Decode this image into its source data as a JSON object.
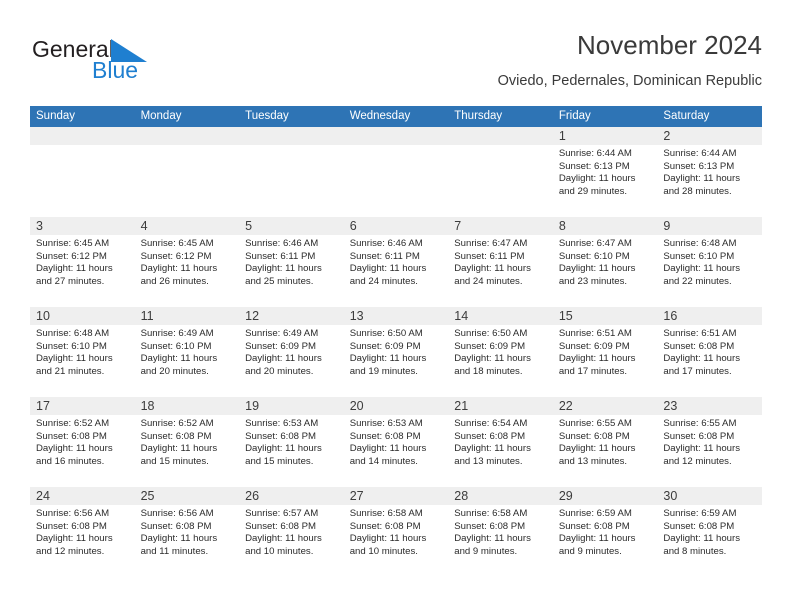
{
  "brand": {
    "name_part1": "General",
    "name_part2": "Blue",
    "accent_color": "#1f7fd0",
    "flag_icon": "blue-flag-triangle-icon"
  },
  "header": {
    "title": "November 2024",
    "subtitle": "Oviedo, Pedernales, Dominican Republic"
  },
  "calendar": {
    "header_bg": "#2e74b5",
    "daynum_bg": "#efefef",
    "weekday_headers": [
      "Sunday",
      "Monday",
      "Tuesday",
      "Wednesday",
      "Thursday",
      "Friday",
      "Saturday"
    ],
    "weeks": [
      [
        {
          "day": "",
          "details": ""
        },
        {
          "day": "",
          "details": ""
        },
        {
          "day": "",
          "details": ""
        },
        {
          "day": "",
          "details": ""
        },
        {
          "day": "",
          "details": ""
        },
        {
          "day": "1",
          "details": "Sunrise: 6:44 AM\nSunset: 6:13 PM\nDaylight: 11 hours\nand 29 minutes."
        },
        {
          "day": "2",
          "details": "Sunrise: 6:44 AM\nSunset: 6:13 PM\nDaylight: 11 hours\nand 28 minutes."
        }
      ],
      [
        {
          "day": "3",
          "details": "Sunrise: 6:45 AM\nSunset: 6:12 PM\nDaylight: 11 hours\nand 27 minutes."
        },
        {
          "day": "4",
          "details": "Sunrise: 6:45 AM\nSunset: 6:12 PM\nDaylight: 11 hours\nand 26 minutes."
        },
        {
          "day": "5",
          "details": "Sunrise: 6:46 AM\nSunset: 6:11 PM\nDaylight: 11 hours\nand 25 minutes."
        },
        {
          "day": "6",
          "details": "Sunrise: 6:46 AM\nSunset: 6:11 PM\nDaylight: 11 hours\nand 24 minutes."
        },
        {
          "day": "7",
          "details": "Sunrise: 6:47 AM\nSunset: 6:11 PM\nDaylight: 11 hours\nand 24 minutes."
        },
        {
          "day": "8",
          "details": "Sunrise: 6:47 AM\nSunset: 6:10 PM\nDaylight: 11 hours\nand 23 minutes."
        },
        {
          "day": "9",
          "details": "Sunrise: 6:48 AM\nSunset: 6:10 PM\nDaylight: 11 hours\nand 22 minutes."
        }
      ],
      [
        {
          "day": "10",
          "details": "Sunrise: 6:48 AM\nSunset: 6:10 PM\nDaylight: 11 hours\nand 21 minutes."
        },
        {
          "day": "11",
          "details": "Sunrise: 6:49 AM\nSunset: 6:10 PM\nDaylight: 11 hours\nand 20 minutes."
        },
        {
          "day": "12",
          "details": "Sunrise: 6:49 AM\nSunset: 6:09 PM\nDaylight: 11 hours\nand 20 minutes."
        },
        {
          "day": "13",
          "details": "Sunrise: 6:50 AM\nSunset: 6:09 PM\nDaylight: 11 hours\nand 19 minutes."
        },
        {
          "day": "14",
          "details": "Sunrise: 6:50 AM\nSunset: 6:09 PM\nDaylight: 11 hours\nand 18 minutes."
        },
        {
          "day": "15",
          "details": "Sunrise: 6:51 AM\nSunset: 6:09 PM\nDaylight: 11 hours\nand 17 minutes."
        },
        {
          "day": "16",
          "details": "Sunrise: 6:51 AM\nSunset: 6:08 PM\nDaylight: 11 hours\nand 17 minutes."
        }
      ],
      [
        {
          "day": "17",
          "details": "Sunrise: 6:52 AM\nSunset: 6:08 PM\nDaylight: 11 hours\nand 16 minutes."
        },
        {
          "day": "18",
          "details": "Sunrise: 6:52 AM\nSunset: 6:08 PM\nDaylight: 11 hours\nand 15 minutes."
        },
        {
          "day": "19",
          "details": "Sunrise: 6:53 AM\nSunset: 6:08 PM\nDaylight: 11 hours\nand 15 minutes."
        },
        {
          "day": "20",
          "details": "Sunrise: 6:53 AM\nSunset: 6:08 PM\nDaylight: 11 hours\nand 14 minutes."
        },
        {
          "day": "21",
          "details": "Sunrise: 6:54 AM\nSunset: 6:08 PM\nDaylight: 11 hours\nand 13 minutes."
        },
        {
          "day": "22",
          "details": "Sunrise: 6:55 AM\nSunset: 6:08 PM\nDaylight: 11 hours\nand 13 minutes."
        },
        {
          "day": "23",
          "details": "Sunrise: 6:55 AM\nSunset: 6:08 PM\nDaylight: 11 hours\nand 12 minutes."
        }
      ],
      [
        {
          "day": "24",
          "details": "Sunrise: 6:56 AM\nSunset: 6:08 PM\nDaylight: 11 hours\nand 12 minutes."
        },
        {
          "day": "25",
          "details": "Sunrise: 6:56 AM\nSunset: 6:08 PM\nDaylight: 11 hours\nand 11 minutes."
        },
        {
          "day": "26",
          "details": "Sunrise: 6:57 AM\nSunset: 6:08 PM\nDaylight: 11 hours\nand 10 minutes."
        },
        {
          "day": "27",
          "details": "Sunrise: 6:58 AM\nSunset: 6:08 PM\nDaylight: 11 hours\nand 10 minutes."
        },
        {
          "day": "28",
          "details": "Sunrise: 6:58 AM\nSunset: 6:08 PM\nDaylight: 11 hours\nand 9 minutes."
        },
        {
          "day": "29",
          "details": "Sunrise: 6:59 AM\nSunset: 6:08 PM\nDaylight: 11 hours\nand 9 minutes."
        },
        {
          "day": "30",
          "details": "Sunrise: 6:59 AM\nSunset: 6:08 PM\nDaylight: 11 hours\nand 8 minutes."
        }
      ]
    ]
  }
}
